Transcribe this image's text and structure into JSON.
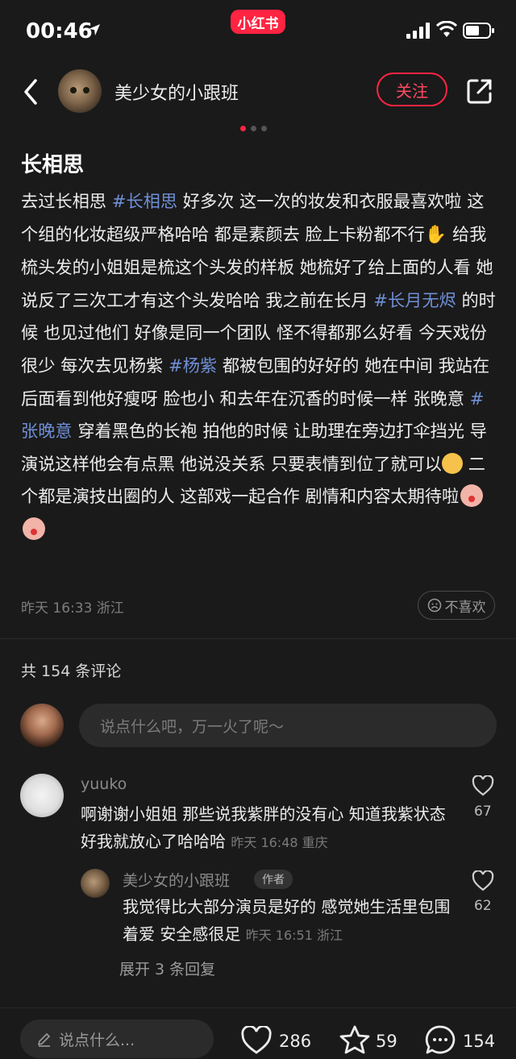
{
  "status_bar": {
    "time": "00:46",
    "app_badge": "小红书"
  },
  "header": {
    "author": "美少女的小跟班",
    "follow_label": "关注"
  },
  "post": {
    "title": "长相思",
    "segments": [
      {
        "t": "去过长相思 "
      },
      {
        "t": "#长相思",
        "tag": true
      },
      {
        "t": " 好多次 这一次的妆发和衣服最喜欢啦 这个组的化妆超级严格哈哈 都是素颜去 脸上卡粉都不行"
      },
      {
        "emoji": "hand",
        "glyph": "✋"
      },
      {
        "t": " 给我梳头发的小姐姐是梳这个头发的样板 她梳好了给上面的人看 她说反了三次工才有这个头发哈哈 我之前在长月 "
      },
      {
        "t": "#长月无烬",
        "tag": true
      },
      {
        "t": " 的时候 也见过他们 好像是同一个团队 怪不得都那么好看 今天戏份很少 每次去见杨紫 "
      },
      {
        "t": "#杨紫",
        "tag": true
      },
      {
        "t": " 都被包围的好好的 她在中间 我站在后面看到他好瘦呀 脸也小 和去年在沉香的时候一样 张晚意 "
      },
      {
        "t": "#张晚意",
        "tag": true
      },
      {
        "t": " 穿着黑色的长袍 拍他的时候 让助理在旁边打伞挡光 导演说这样他会有点黑 他说没关系 只要表情到位了就可以"
      },
      {
        "emoji": "relieved-face"
      },
      {
        "t": " 二个都是演技出圈的人 这部戏一起合作 剧情和内容太期待啦"
      },
      {
        "emoji": "baby"
      },
      {
        "emoji": "baby"
      }
    ],
    "meta": "昨天 16:33 浙江",
    "dislike_label": "不喜欢"
  },
  "comments_section": {
    "count_label": "共 154 条评论",
    "input_placeholder": "说点什么吧，万一火了呢～",
    "comments": [
      {
        "user": "yuuko",
        "text": "啊谢谢小姐姐 那些说我紫胖的没有心 知道我紫状态好我就放心了哈哈哈",
        "meta": "昨天 16:48 重庆",
        "likes": "67"
      }
    ],
    "reply": {
      "user": "美少女的小跟班",
      "badge": "作者",
      "text": "我觉得比大部分演员是好的 感觉她生活里包围着爱 安全感很足",
      "meta": "昨天 16:51 浙江",
      "likes": "62"
    },
    "expand_label": "展开 3 条回复"
  },
  "bottom_bar": {
    "input_placeholder": "说点什么...",
    "likes": "286",
    "favorites": "59",
    "comments": "154"
  },
  "colors": {
    "accent": "#ff2442",
    "tag": "#6f8fd6",
    "background": "#1a1a1a"
  }
}
